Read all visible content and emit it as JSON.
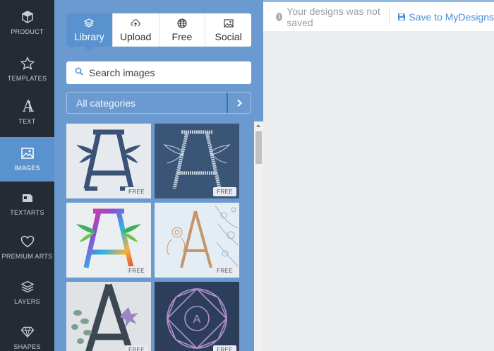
{
  "rail": {
    "items": [
      {
        "label": "PRODUCT",
        "icon": "cube-icon"
      },
      {
        "label": "TEMPLATES",
        "icon": "star-icon"
      },
      {
        "label": "TEXT",
        "icon": "text-a-icon"
      },
      {
        "label": "IMAGES",
        "icon": "image-icon"
      },
      {
        "label": "TEXTARTS",
        "icon": "textart-icon"
      },
      {
        "label": "PREMIUM ARTS",
        "icon": "heart-icon"
      },
      {
        "label": "LAYERS",
        "icon": "layers-icon"
      },
      {
        "label": "SHAPES",
        "icon": "diamond-icon"
      }
    ],
    "active": "IMAGES"
  },
  "panel": {
    "tabs": [
      {
        "label": "Library",
        "icon": "layers-icon"
      },
      {
        "label": "Upload",
        "icon": "cloud-upload-icon"
      },
      {
        "label": "Free",
        "icon": "globe-icon"
      },
      {
        "label": "Social",
        "icon": "image-icon"
      }
    ],
    "search_placeholder": "Search images",
    "category": "All categories",
    "badge": "FREE"
  },
  "topbar": {
    "status": "Your designs was not saved",
    "save": "Save to MyDesigns"
  },
  "colors": {
    "rail_bg": "#252b33",
    "panel_bg": "#6a9ad0",
    "accent": "#5a92cf",
    "link": "#4a90d9"
  }
}
